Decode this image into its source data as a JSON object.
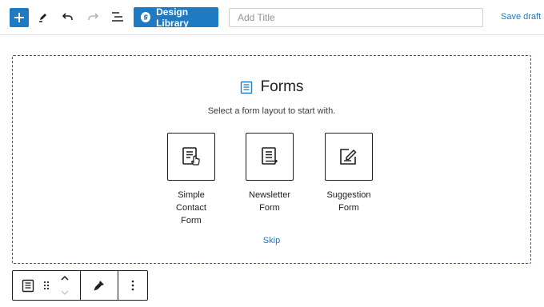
{
  "toolbar": {
    "design_library_label": "Design Library",
    "title_placeholder": "Add Title",
    "save_draft_label": "Save draft",
    "accent_color": "#1f7ac4"
  },
  "icons": {
    "add": "plus-icon",
    "tools": "pencil-icon",
    "undo": "undo-icon",
    "redo": "redo-icon",
    "outline": "list-view-icon",
    "design_library_logo": "stackable-logo-icon"
  },
  "forms_block": {
    "title": "Forms",
    "subtitle": "Select a form layout to start with.",
    "options": [
      {
        "line1": "Simple",
        "line2": "Contact",
        "line3": "Form",
        "icon": "contact-form-icon"
      },
      {
        "line1": "Newsletter",
        "line2": "Form",
        "line3": "",
        "icon": "newsletter-form-icon"
      },
      {
        "line1": "Suggestion",
        "line2": "Form",
        "line3": "",
        "icon": "suggestion-form-icon"
      }
    ],
    "skip_label": "Skip"
  },
  "block_toolbar": {
    "items": [
      "form-block-icon",
      "drag-handle-icon",
      "move-up-icon",
      "move-down-icon",
      "brush-icon",
      "more-options-icon"
    ]
  }
}
